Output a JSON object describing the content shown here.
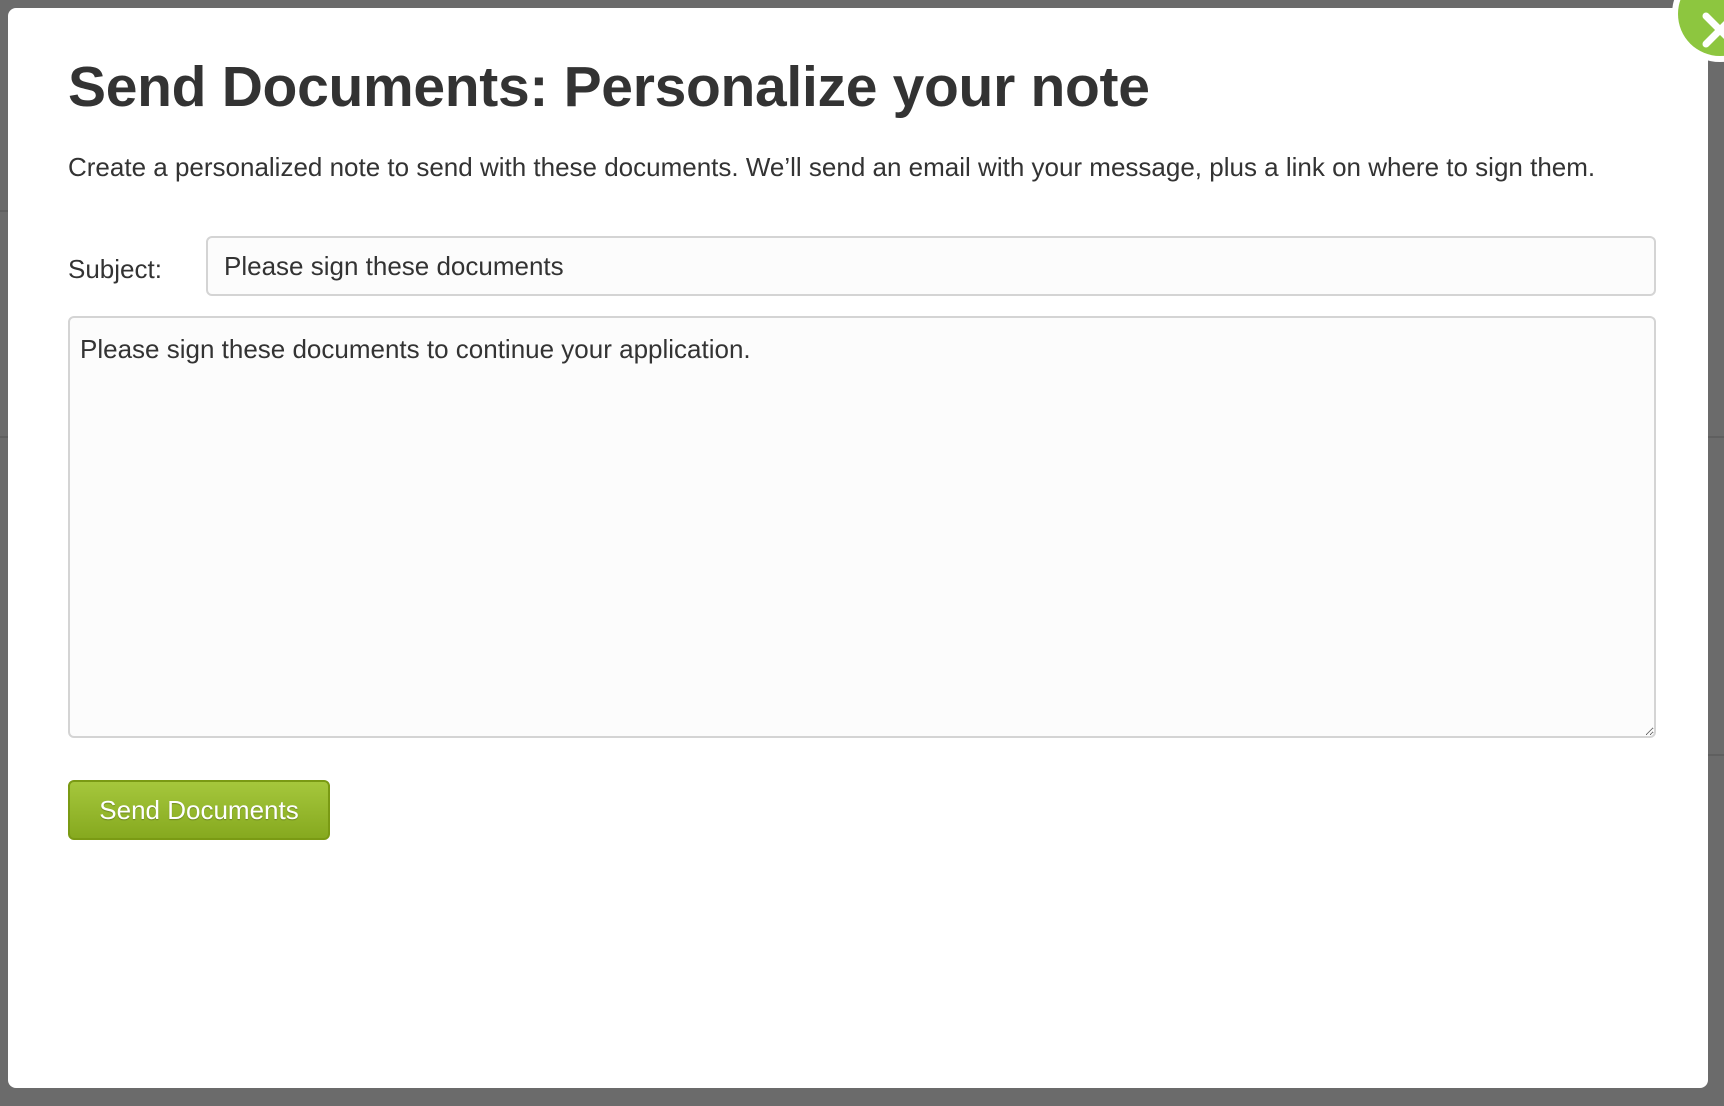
{
  "modal": {
    "title": "Send Documents: Personalize your note",
    "description": "Create a personalized note to send with these documents. We’ll send an email with your message, plus a link on where to sign them.",
    "subject_label": "Subject:",
    "subject_value": "Please sign these documents",
    "message_value": "Please sign these documents to continue your application.",
    "send_button_label": "Send Documents",
    "close_icon": "close-x-icon"
  },
  "colors": {
    "accent_green": "#8dc63f",
    "button_green": "#96b82c",
    "overlay": "#6b6b6b"
  }
}
